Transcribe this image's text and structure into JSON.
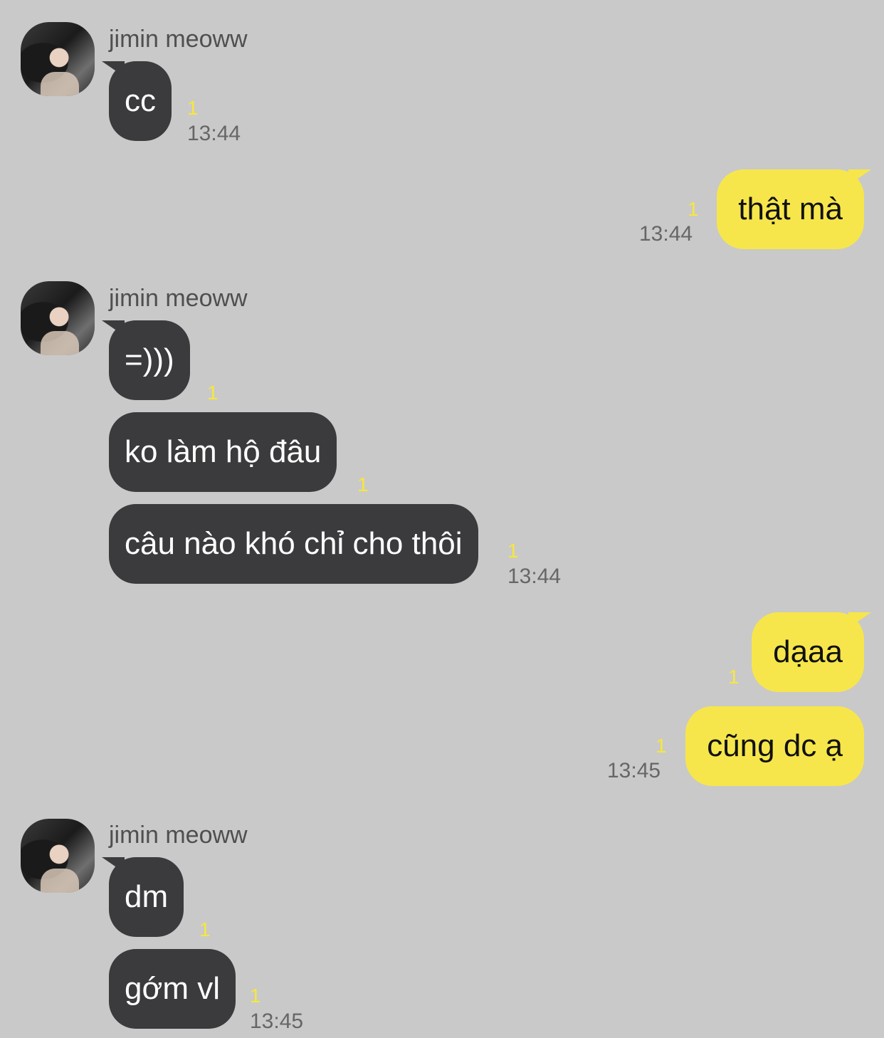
{
  "chat": {
    "sender_name": "jimin meoww",
    "avatar_icon": "profile-photo",
    "colors": {
      "background": "#c9c9c9",
      "incoming_bubble": "#3b3b3d",
      "outgoing_bubble": "#f6e64b",
      "unread_marker": "#f7e73c",
      "timestamp": "#666666"
    },
    "messages": [
      {
        "from": "jimin meoww",
        "text": "cc",
        "unread": "1",
        "time": "13:44"
      },
      {
        "from": "me",
        "text": "thật mà",
        "unread": "1",
        "time": "13:44"
      },
      {
        "from": "jimin meoww",
        "text": "=)))",
        "unread": "1"
      },
      {
        "from": "jimin meoww",
        "text": "ko làm hộ đâu",
        "unread": "1"
      },
      {
        "from": "jimin meoww",
        "text": "câu nào khó chỉ cho thôi",
        "unread": "1",
        "time": "13:44"
      },
      {
        "from": "me",
        "text": "dạaa",
        "unread": "1"
      },
      {
        "from": "me",
        "text": "cũng dc ạ",
        "unread": "1",
        "time": "13:45"
      },
      {
        "from": "jimin meoww",
        "text": "dm",
        "unread": "1"
      },
      {
        "from": "jimin meoww",
        "text": "gớm vl",
        "unread": "1",
        "time": "13:45"
      }
    ]
  }
}
